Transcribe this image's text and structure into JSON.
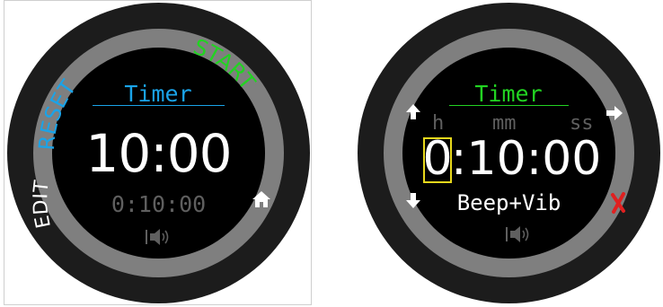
{
  "colors": {
    "title_blue": "#1aa3e8",
    "title_green": "#22d322",
    "reset": "#1aa3e8",
    "start": "#22d322",
    "edit": "#ffffff",
    "cancel": "#e02020",
    "focus_box": "#e8d81c",
    "dim": "#5f5f5f",
    "bezel": "#7f7f7f"
  },
  "left_screen": {
    "title": "Timer",
    "reset_label": "RESET",
    "start_label": "START",
    "edit_label": "EDIT",
    "main_time": "10:00",
    "sub_time": "0:10:00",
    "home_icon": "home-icon",
    "sound_icon": "speaker-vibrate-icon"
  },
  "right_screen": {
    "title": "Timer",
    "unit_h": "h",
    "unit_mm": "mm",
    "unit_ss": "ss",
    "hours_value": "0",
    "rest_time": ":10:00",
    "alert_mode": "Beep+Vib",
    "up_icon": "arrow-up-icon",
    "down_icon": "arrow-down-icon",
    "next_icon": "arrow-right-icon",
    "cancel_icon": "cross-icon",
    "sound_icon": "speaker-vibrate-icon"
  }
}
